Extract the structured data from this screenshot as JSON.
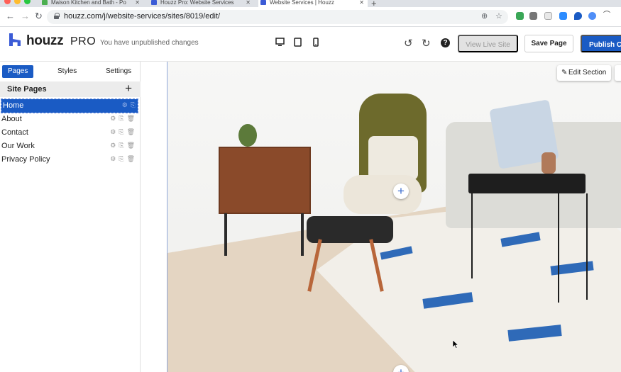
{
  "browser": {
    "tabs": [
      {
        "title": "Maison Kitchen and Bath - Po",
        "active": false
      },
      {
        "title": "Houzz Pro: Website Services",
        "active": false
      },
      {
        "title": "Website Services | Houzz",
        "active": true
      }
    ],
    "new_tab": "+",
    "url": "houzz.com/j/website-services/sites/8019/edit/"
  },
  "header": {
    "logo_word": "houzz",
    "logo_suffix": "PRO",
    "status": "You have unpublished changes",
    "view_live_label": "View Live Site",
    "save_label": "Save Page",
    "publish_label": "Publish Ch",
    "help_glyph": "?"
  },
  "sidebar": {
    "tabs": [
      {
        "label": "Pages",
        "active": true
      },
      {
        "label": "Styles",
        "active": false
      },
      {
        "label": "Settings",
        "active": false
      }
    ],
    "section_title": "Site Pages",
    "add_glyph": "+",
    "pages": [
      {
        "label": "Home",
        "active": true
      },
      {
        "label": "About",
        "active": false
      },
      {
        "label": "Contact",
        "active": false
      },
      {
        "label": "Our Work",
        "active": false
      },
      {
        "label": "Privacy Policy",
        "active": false
      }
    ]
  },
  "canvas": {
    "edit_section_label": "Edit Section",
    "add_glyph": "+"
  },
  "colors": {
    "brand_blue": "#1a5bc4",
    "logo_blue": "#3b5bd6",
    "rug_blue": "#2f6ab8"
  }
}
